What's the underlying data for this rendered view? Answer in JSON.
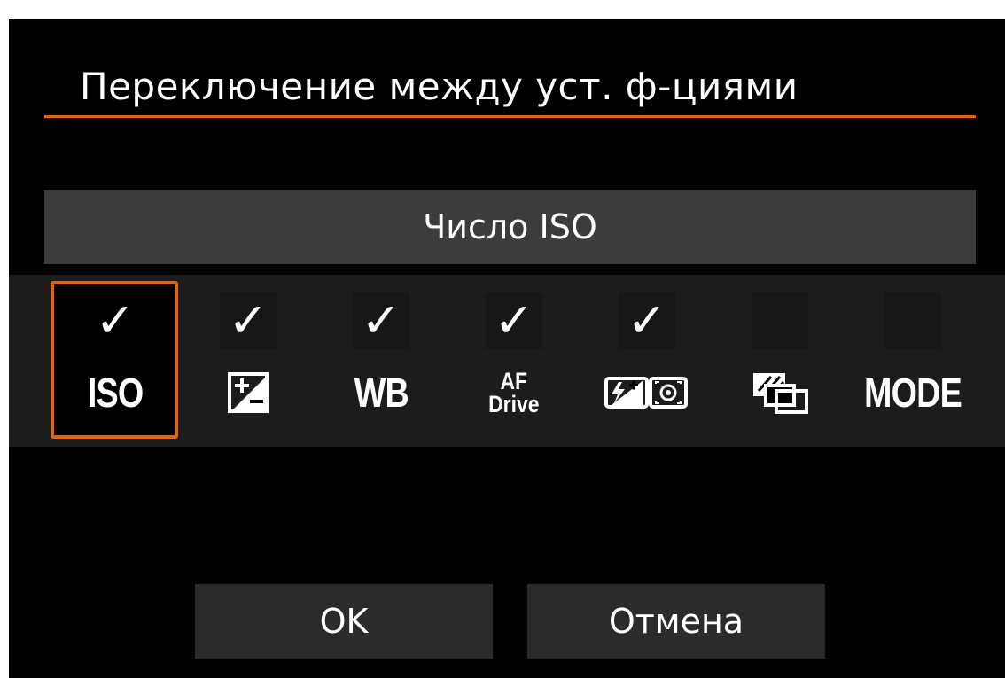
{
  "title": "Переключение между уст. ф-циями",
  "current_function_name": "Число ISO",
  "functions": [
    {
      "label": "ISO",
      "icon": "iso-label",
      "checked": true,
      "selected": true
    },
    {
      "label": "",
      "icon": "exposure-compensation-icon",
      "checked": true,
      "selected": false
    },
    {
      "label": "WB",
      "icon": "white-balance-label",
      "checked": true,
      "selected": false
    },
    {
      "label_line1": "AF",
      "label_line2": "Drive",
      "icon": "af-drive-label",
      "checked": true,
      "selected": false
    },
    {
      "label": "",
      "icon": "flash-exposure-metering-icon",
      "checked": true,
      "selected": false
    },
    {
      "label": "",
      "icon": "multi-shot-icon",
      "checked": false,
      "selected": false
    },
    {
      "label": "MODE",
      "icon": "mode-label",
      "checked": false,
      "selected": false
    }
  ],
  "check_glyph": "✓",
  "buttons": {
    "ok": "OK",
    "cancel": "Отмена"
  },
  "colors": {
    "accent": "#d9651f",
    "background": "#000000",
    "bar": "#3c3c3c"
  }
}
